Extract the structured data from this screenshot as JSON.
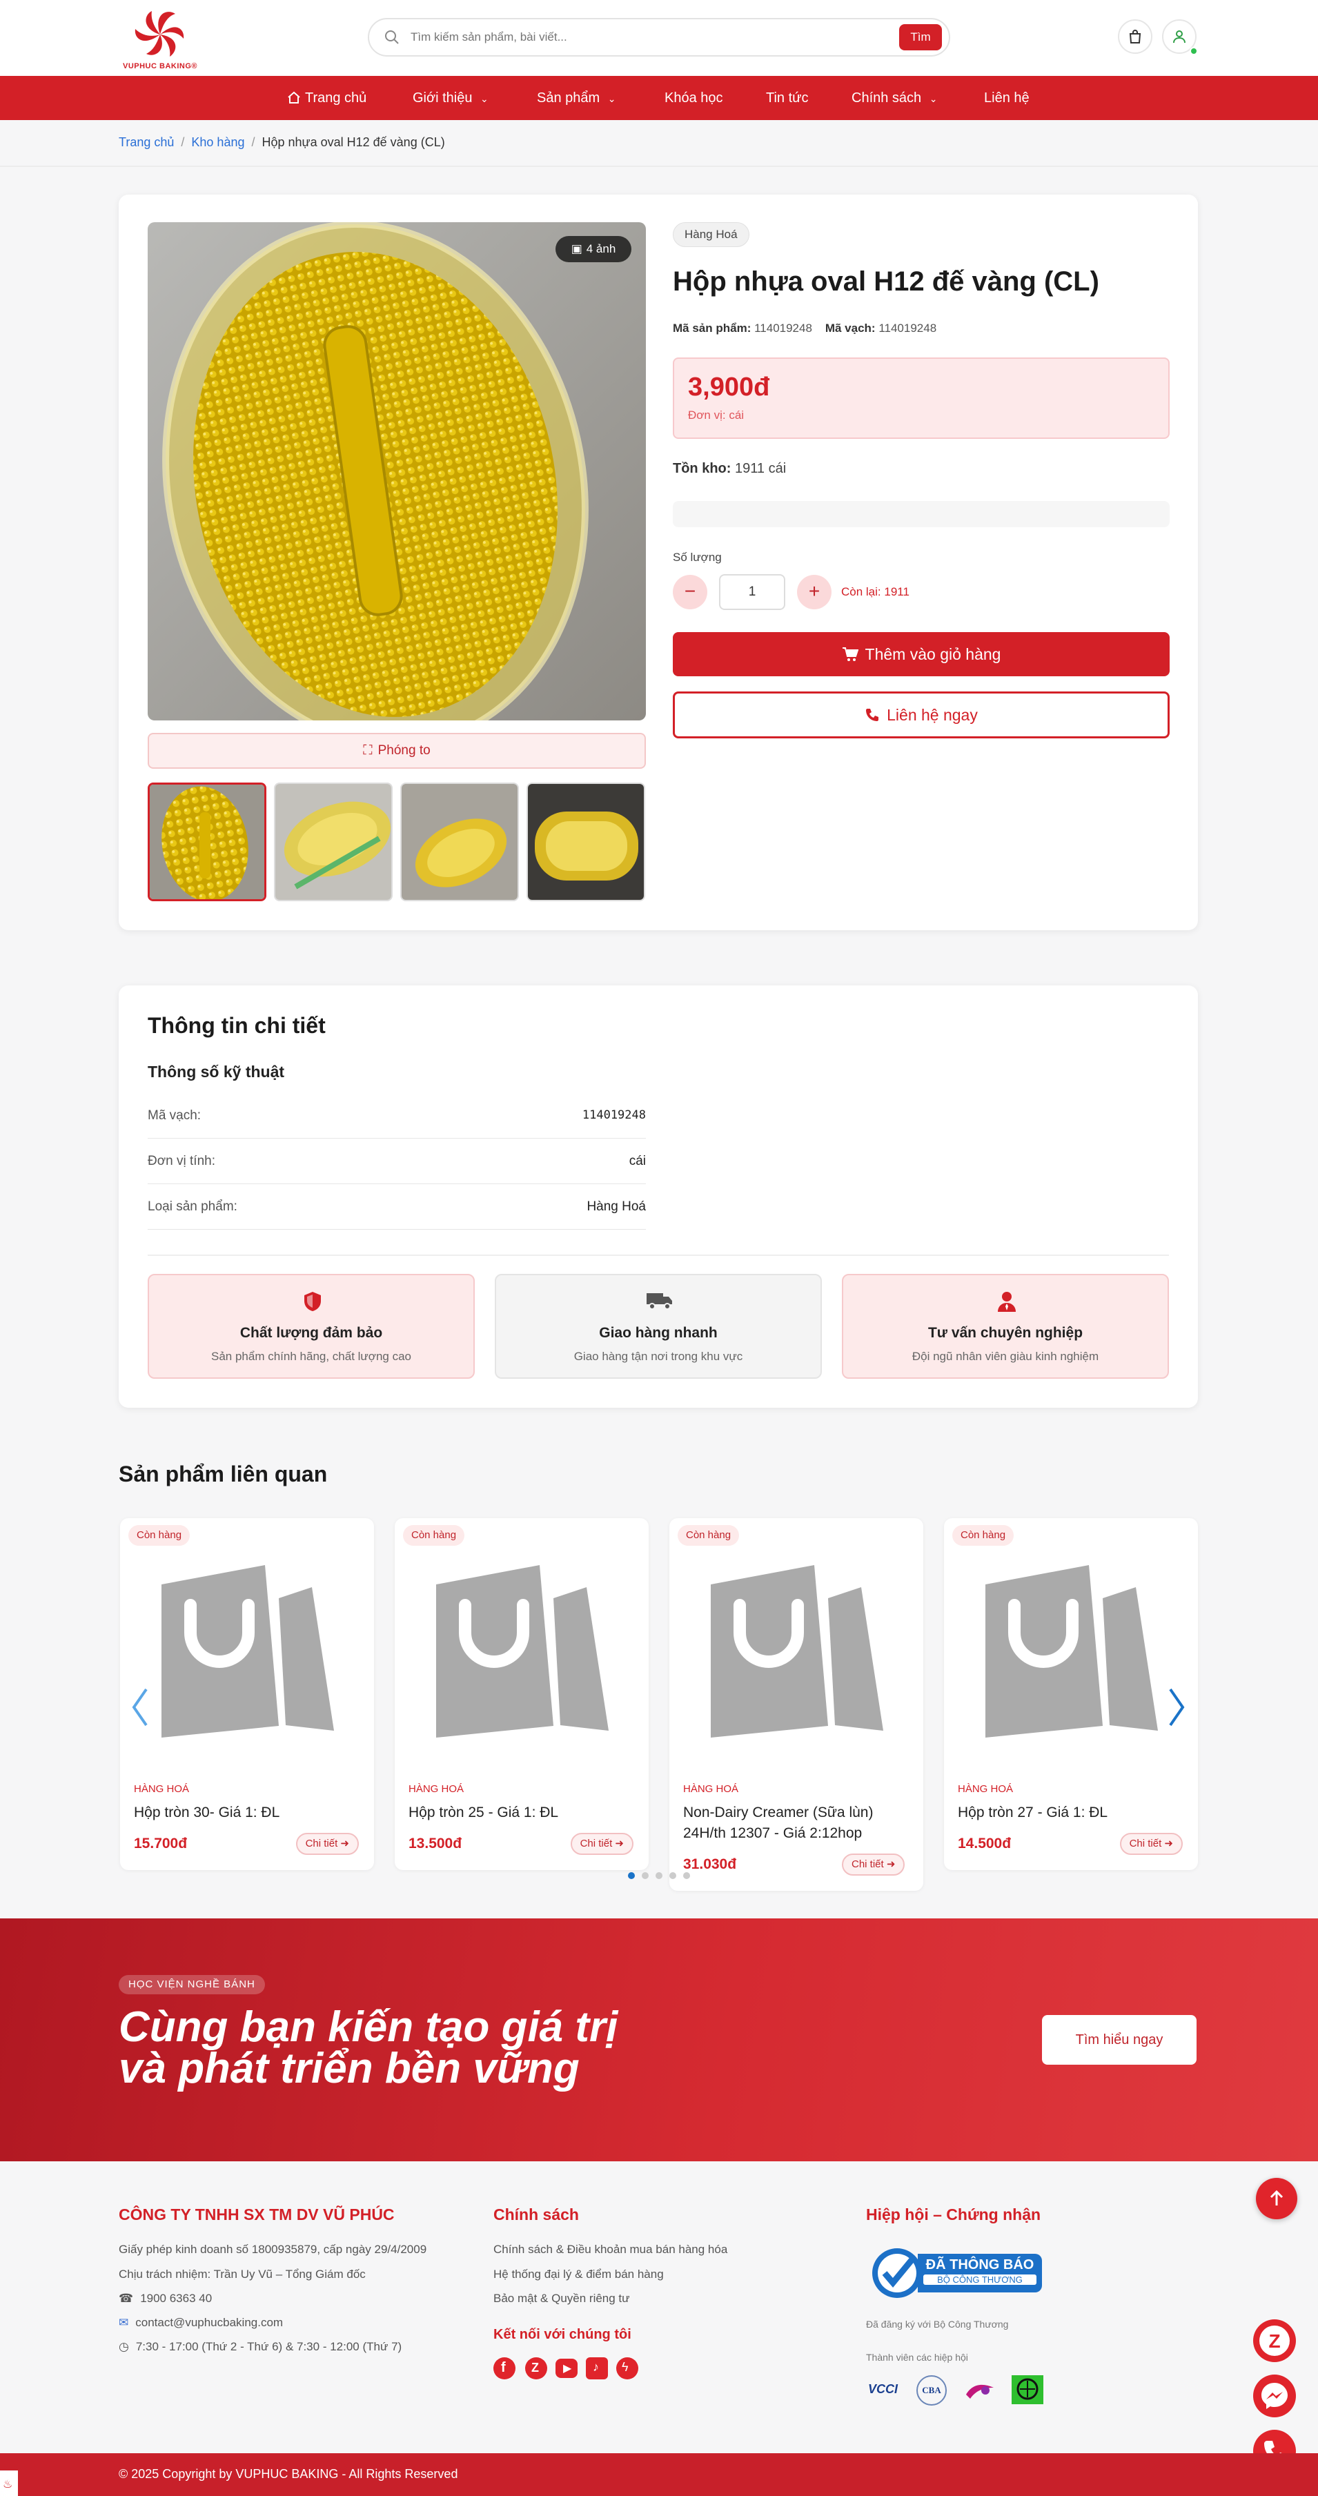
{
  "header": {
    "logo_text": "VUPHUC BAKING®",
    "search_placeholder": "Tìm kiếm sản phẩm, bài viết...",
    "search_button": "Tìm"
  },
  "nav": {
    "items": [
      {
        "label": "Trang chủ"
      },
      {
        "label": "Giới thiệu"
      },
      {
        "label": "Sản phẩm"
      },
      {
        "label": "Khóa học"
      },
      {
        "label": "Tin tức"
      },
      {
        "label": "Chính sách"
      },
      {
        "label": "Liên hệ"
      }
    ]
  },
  "breadcrumb": {
    "home": "Trang chủ",
    "category": "Kho hàng",
    "current": "Hộp nhựa oval H12 đế vàng (CL)"
  },
  "product": {
    "image_count": "4 ảnh",
    "zoom_label": "Phóng to",
    "badge": "Hàng Hoá",
    "title": "Hộp nhựa oval H12 đế vàng (CL)",
    "sku_label": "Mã sản phẩm:",
    "sku": "114019248",
    "barcode_label": "Mã vạch:",
    "barcode": "114019248",
    "price": "3,900đ",
    "unit": "Đơn vị: cái",
    "stock_label": "Tồn kho:",
    "stock": "1911 cái",
    "qty_label": "Số lượng",
    "qty_value": "1",
    "remaining": "Còn lại: 1911",
    "add_to_cart": "Thêm vào giỏ hàng",
    "contact_now": "Liên hệ ngay"
  },
  "details": {
    "title": "Thông tin chi tiết",
    "spec_title": "Thông số kỹ thuật",
    "specs": [
      {
        "key": "Mã vạch:",
        "value": "114019248"
      },
      {
        "key": "Đơn vị tính:",
        "value": "cái"
      },
      {
        "key": "Loại sản phẩm:",
        "value": "Hàng Hoá"
      }
    ],
    "features": [
      {
        "title": "Chất lượng đảm bảo",
        "desc": "Sản phẩm chính hãng, chất lượng cao"
      },
      {
        "title": "Giao hàng nhanh",
        "desc": "Giao hàng tận nơi trong khu vực"
      },
      {
        "title": "Tư vấn chuyên nghiệp",
        "desc": "Đội ngũ nhân viên giàu kinh nghiệm"
      }
    ]
  },
  "related": {
    "title": "Sản phẩm liên quan",
    "items": [
      {
        "tag": "Còn hàng",
        "category": "HÀNG HOÁ",
        "name": "Hộp tròn 30- Giá 1: ĐL",
        "price": "15.700đ",
        "detail": "Chi tiết"
      },
      {
        "tag": "Còn hàng",
        "category": "HÀNG HOÁ",
        "name": "Hộp tròn 25 - Giá 1: ĐL",
        "price": "13.500đ",
        "detail": "Chi tiết"
      },
      {
        "tag": "Còn hàng",
        "category": "HÀNG HOÁ",
        "name": "Non-Dairy Creamer (Sữa lùn) 24H/th 12307 - Giá 2:12hop",
        "price": "31.030đ",
        "detail": "Chi tiết"
      },
      {
        "tag": "Còn hàng",
        "category": "HÀNG HOÁ",
        "name": "Hộp tròn 27 - Giá 1: ĐL",
        "price": "14.500đ",
        "detail": "Chi tiết"
      }
    ]
  },
  "banner": {
    "tag": "HỌC VIỆN NGHỀ BÁNH",
    "line1": "Cùng bạn kiến tạo giá trị",
    "line2": "và phát triển bền vững",
    "button": "Tìm hiểu ngay"
  },
  "footer": {
    "company": "CÔNG TY TNHH SX TM DV VŨ PHÚC",
    "license": "Giấy phép kinh doanh số 1800935879, cấp ngày 29/4/2009",
    "responsible": "Chịu trách nhiệm: Trần Uy Vũ – Tổng Giám đốc",
    "phone": "1900 6363 40",
    "email": "contact@vuphucbaking.com",
    "hours": "7:30 - 17:00 (Thứ 2 - Thứ 6) & 7:30 - 12:00 (Thứ 7)",
    "policy_title": "Chính sách",
    "policies": [
      "Chính sách & Điều khoản mua bán hàng hóa",
      "Hệ thống đại lý & điểm bán hàng",
      "Bảo mật & Quyền riêng tư"
    ],
    "connect_title": "Kết nối với chúng tôi",
    "assoc_title": "Hiệp hội – Chứng nhận",
    "cert_line1": "ĐÃ THÔNG BÁO",
    "cert_line2": "BỘ CÔNG THƯƠNG",
    "registered": "Đã đăng ký với Bộ Công Thương",
    "member": "Thành viên các hiệp hội",
    "assoc_logos": [
      "VCCI",
      "CBA",
      "",
      ""
    ],
    "copyright": "© 2025 Copyright by VUPHUC BAKING - All Rights Reserved"
  },
  "colors": {
    "brand": "#d32027",
    "link": "#2a6fd6"
  }
}
